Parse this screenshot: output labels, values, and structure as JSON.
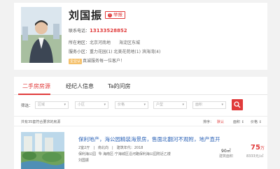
{
  "agent": {
    "name": "刘国振",
    "report_label": "举报",
    "phone_label": "联系电话：",
    "phone": "13133528852",
    "region_label": "所在地区：",
    "region_value": "北京河南地　　海淀区东城",
    "service_label": "服务小区：",
    "service_value": "重力花园(1) 北美花苑地(1) 滨海湾(4)",
    "tag": "企业认",
    "tag_desc": "真诚服务每一位客户！"
  },
  "tabs": [
    "二手房房源",
    "经纪人信息",
    "Ta的问房"
  ],
  "filters": {
    "label": "筛选：",
    "selects": [
      {
        "placeholder": "区域"
      },
      {
        "placeholder": "小区"
      },
      {
        "placeholder": "价格"
      },
      {
        "placeholder": "户型"
      },
      {
        "placeholder": "面积"
      }
    ]
  },
  "results": {
    "count_text": "共有35套符合要求的房源",
    "sort_label": "排序：",
    "sort_options": [
      "默认",
      "面积 ↕",
      "价格 ↕"
    ]
  },
  "listing": {
    "title": "保利地产，海公园精装海景房，售面北翻河不观附，地产直开",
    "line1": "2室2厅　|　南北向　|　建筑年代：2018",
    "line2_prefix": "保利海公园",
    "line2_loc": "海南区-宁海城区沿河路保利海公园附近乙楼",
    "line3": "刘国振",
    "area_value": "90㎡",
    "area_label": "建筑面积",
    "price": "75",
    "price_unit": "万",
    "unit_price": "8333元/㎡"
  }
}
